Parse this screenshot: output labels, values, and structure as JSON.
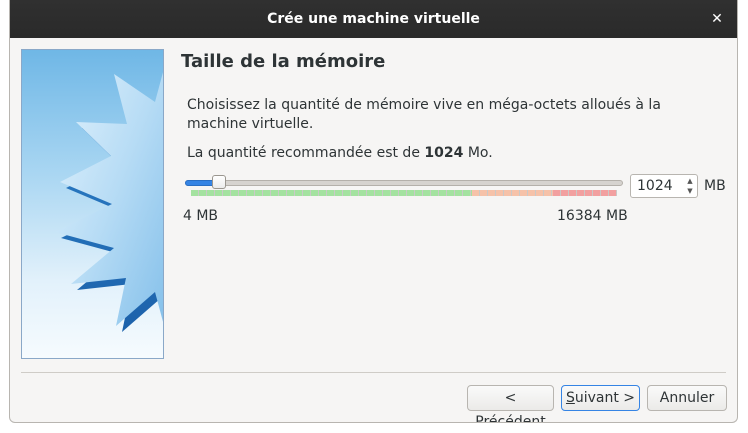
{
  "window": {
    "title": "Crée une machine virtuelle",
    "close_icon": "close-icon"
  },
  "page": {
    "heading": "Taille de la mémoire",
    "description": "Choisissez la quantité de mémoire vive en méga-octets alloués à la machine virtuelle.",
    "recommended_prefix": "La quantité recommandée est de",
    "recommended_value": "1024",
    "recommended_suffix": "Mo."
  },
  "memory": {
    "value": "1024",
    "value_mb": 1024,
    "min_label": "4 MB",
    "max_label": "16384 MB",
    "min_mb": 4,
    "max_mb": 16384,
    "unit": "MB",
    "zone_colors": {
      "safe": "#a4e2a0",
      "warning": "#f6c2a9",
      "danger": "#f2a0a0"
    },
    "accent": "#3584e4"
  },
  "buttons": {
    "prev_mnemonic": "P",
    "prev_rest": "récédent",
    "prev_prefix": "< ",
    "next_mnemonic": "S",
    "next_rest": "uivant >",
    "cancel": "Annuler"
  }
}
